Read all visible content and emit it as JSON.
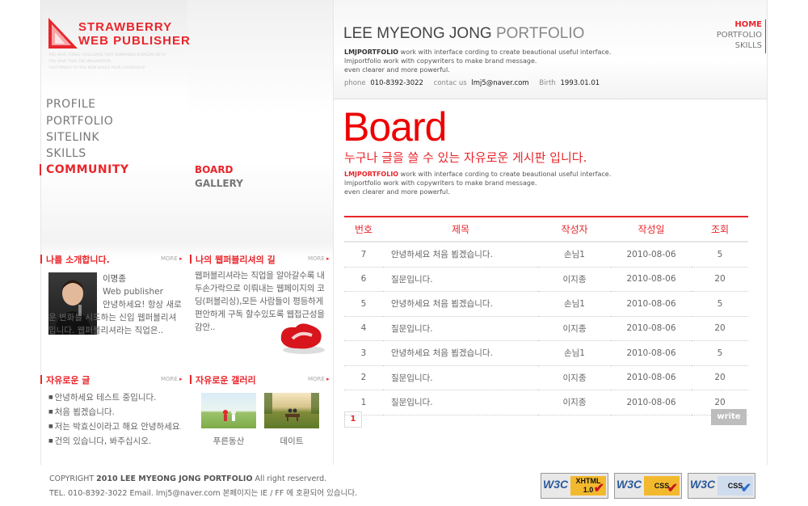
{
  "logo": {
    "line1": "STRAWBERRY",
    "line2": "WEB PUBLISHER",
    "tagline": [
      "YOU HAVE THREE CHALLENGE THAT REMEMBER SOMEDAY BETH",
      "YOU HAVE TAKE THE IMAGINATION",
      "THAT MAKES TO YOU NEW BASED YOUR LEADERSHIP"
    ]
  },
  "main_nav": [
    {
      "label": "PROFILE",
      "active": false
    },
    {
      "label": "PORTFOLIO",
      "active": false
    },
    {
      "label": "SITELINK",
      "active": false
    },
    {
      "label": "SKILLS",
      "active": false
    },
    {
      "label": "COMMUNITY",
      "active": true
    }
  ],
  "sub_nav": [
    {
      "label": "BOARD",
      "active": true
    },
    {
      "label": "GALLERY",
      "active": false
    }
  ],
  "header": {
    "title_bold": "LEE MYEONG JONG",
    "title_light": "PORTFOLIO",
    "intro_brand": "LMJPORTFOLIO",
    "intro_line1": " work with interface cording to create beautional useful interface.",
    "intro_line2": "lmjportfolio work with copywriters to make brand message.",
    "intro_line3": "even clearer and more powerful.",
    "contact": {
      "phone_label": "phone",
      "phone": "010-8392-3022",
      "email_label": "contac us",
      "email": "lmj5@naver.com",
      "birth_label": "Birth",
      "birth": "1993.01.01"
    }
  },
  "top_nav": [
    {
      "label": "HOME",
      "active": true
    },
    {
      "label": "PORTFOLIO",
      "active": false
    },
    {
      "label": "SKILLS",
      "active": false
    }
  ],
  "profile_box": {
    "title": "나를 소개합니다.",
    "more": "MORE",
    "name": "이명종",
    "role": "Web publisher",
    "text": "안녕하세요! 항상 새로운 변화를 시도하는 신입 웹퍼블리셔입니다. 웹퍼블리셔라는 직업은.."
  },
  "path_box": {
    "title": "나의 웹퍼블리셔의 길",
    "more": "MORE",
    "text": "웹퍼블리셔라는 직업을 알아갈수록 내두손가락으로 이뤄내는 웹페이지의 코딩(퍼블리싱),모든 사람들이 평등하게 편안하게 구독 할수있도록 웹접근성을 감안.."
  },
  "free_post_box": {
    "title": "자유로운 글",
    "more": "MORE",
    "items": [
      "안녕하세요 테스트 중입니다.",
      "처음 뵙겠습니다.",
      "저는 박효신이라고 해요 안녕하세요.",
      "건의 있습니다, 봐주십시오."
    ]
  },
  "gallery_box": {
    "title": "자유로운 갤러리",
    "more": "MORE",
    "items": [
      {
        "caption": "푸른동산"
      },
      {
        "caption": "데이트"
      }
    ]
  },
  "board": {
    "title": "Board",
    "subtitle": "누구나 글을 쓸 수 있는 자유로운 게시판 입니다.",
    "desc_brand": "LMJPORTFOLIO",
    "desc_line1": " work with interface cording to create beautional useful interface.",
    "desc_line2": "lmjportfolio work with copywriters to make brand message.",
    "desc_line3": "even clearer and more powerful.",
    "columns": [
      "번호",
      "제목",
      "작성자",
      "작성일",
      "조회"
    ],
    "rows": [
      {
        "no": "7",
        "subject": "안녕하세요 처음 뵙겠습니다.",
        "author": "손님1",
        "date": "2010-08-06",
        "views": "5"
      },
      {
        "no": "6",
        "subject": "질문입니다.",
        "author": "이지종",
        "date": "2010-08-06",
        "views": "20"
      },
      {
        "no": "5",
        "subject": "안녕하세요 처음 뵙겠습니다.",
        "author": "손님1",
        "date": "2010-08-06",
        "views": "5"
      },
      {
        "no": "4",
        "subject": "질문입니다.",
        "author": "이지종",
        "date": "2010-08-06",
        "views": "20"
      },
      {
        "no": "3",
        "subject": "안녕하세요 처음 뵙겠습니다.",
        "author": "손님1",
        "date": "2010-08-06",
        "views": "5"
      },
      {
        "no": "2",
        "subject": "질문입니다.",
        "author": "이지종",
        "date": "2010-08-06",
        "views": "20"
      },
      {
        "no": "1",
        "subject": "질문입니다.",
        "author": "이지종",
        "date": "2010-08-06",
        "views": "20"
      }
    ],
    "current_page": "1",
    "write_label": "write"
  },
  "footer": {
    "copyright_prefix": "COPYRIGHT ",
    "copyright_bold": "2010 LEE MYEONG JONG PORTFOLIO",
    "copyright_suffix": " All right reserverd.",
    "contact_line": "TEL. 010-8392-3022 Email. lmj5@naver.com 본페이지는 IE / FF 에 호환되어 있습니다."
  },
  "badges": [
    {
      "w3c": "W3C",
      "label": "XHTML 1.0"
    },
    {
      "w3c": "W3C",
      "label": "CSS"
    },
    {
      "w3c": "W3C",
      "label": "CSS"
    }
  ],
  "colors": {
    "accent": "#e8262c",
    "gray_text": "#666666"
  }
}
